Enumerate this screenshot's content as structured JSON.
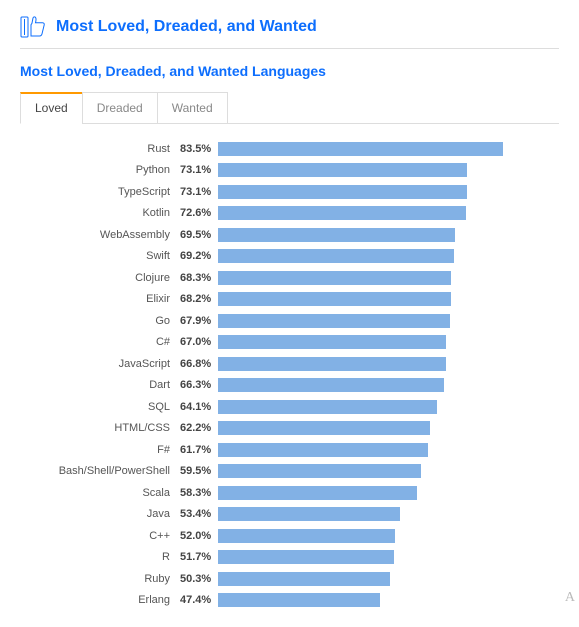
{
  "header": {
    "title": "Most Loved, Dreaded, and Wanted",
    "subtitle": "Most Loved, Dreaded, and Wanted Languages"
  },
  "tabs": [
    {
      "id": "loved",
      "label": "Loved",
      "active": true
    },
    {
      "id": "dreaded",
      "label": "Dreaded",
      "active": false
    },
    {
      "id": "wanted",
      "label": "Wanted",
      "active": false
    }
  ],
  "chart_data": {
    "type": "bar",
    "title": "Most Loved, Dreaded, and Wanted Languages",
    "xlabel": "",
    "ylabel": "",
    "xlim": [
      0,
      100
    ],
    "categories": [
      "Rust",
      "Python",
      "TypeScript",
      "Kotlin",
      "WebAssembly",
      "Swift",
      "Clojure",
      "Elixir",
      "Go",
      "C#",
      "JavaScript",
      "Dart",
      "SQL",
      "HTML/CSS",
      "F#",
      "Bash/Shell/PowerShell",
      "Scala",
      "Java",
      "C++",
      "R",
      "Ruby",
      "Erlang"
    ],
    "values": [
      83.5,
      73.1,
      73.1,
      72.6,
      69.5,
      69.2,
      68.3,
      68.2,
      67.9,
      67.0,
      66.8,
      66.3,
      64.1,
      62.2,
      61.7,
      59.5,
      58.3,
      53.4,
      52.0,
      51.7,
      50.3,
      47.4
    ]
  },
  "footer": {
    "letter": "A"
  }
}
